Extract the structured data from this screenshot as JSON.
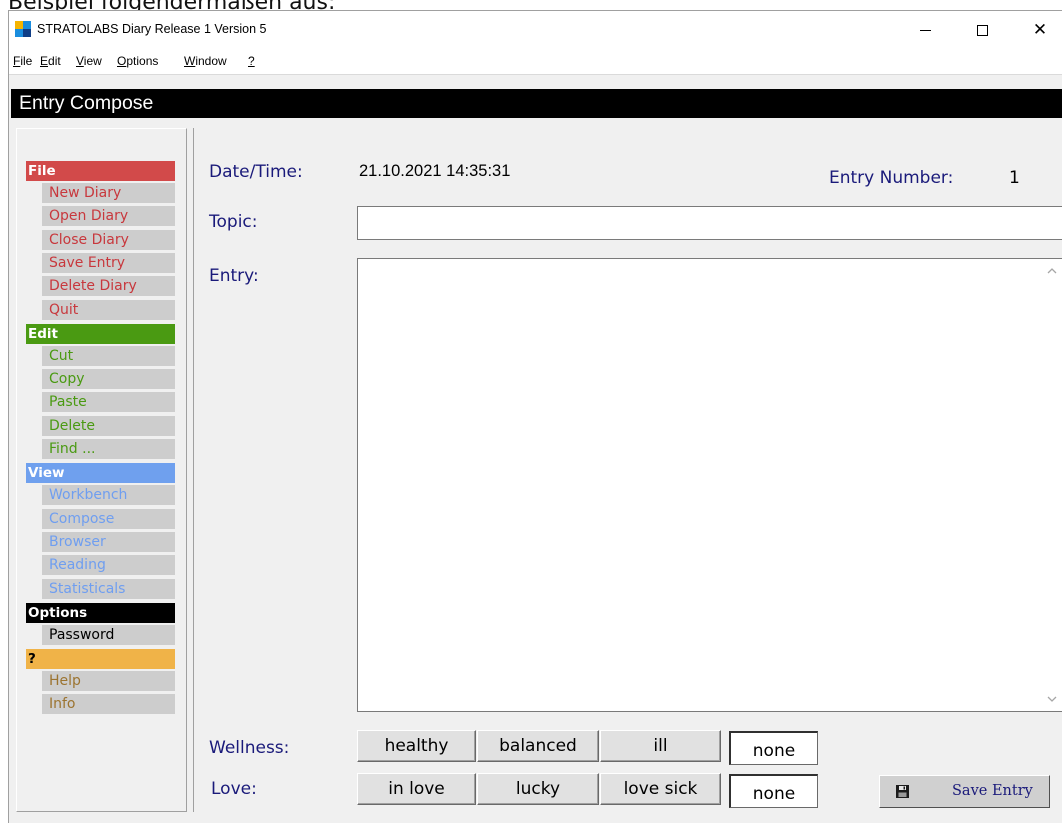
{
  "caption": "Beispiel folgendermaßen aus:",
  "window": {
    "title": "STRATOLABS Diary Release 1 Version 5",
    "controls": {
      "minimize": "—",
      "maximize": "☐",
      "close": "✕"
    }
  },
  "menubar": [
    {
      "u": "F",
      "rest": "ile"
    },
    {
      "u": "E",
      "rest": "dit"
    },
    {
      "u": "V",
      "rest": "iew"
    },
    {
      "u": "O",
      "rest": "ptions"
    },
    {
      "u": "W",
      "rest": "indow"
    },
    {
      "u": "?",
      "rest": ""
    }
  ],
  "section_title": "Entry Compose",
  "sidebar": {
    "groups": [
      {
        "title": "File",
        "head_bg": "#d24a4a",
        "head_color": "#ffffff",
        "item_color": "#c8383d",
        "items": [
          "New Diary",
          "Open Diary",
          "Close Diary",
          "Save Entry",
          "Delete Diary",
          "Quit"
        ]
      },
      {
        "title": "Edit",
        "head_bg": "#4a9a12",
        "head_color": "#ffffff",
        "item_color": "#4a9a12",
        "items": [
          "Cut",
          "Copy",
          "Paste",
          "Delete",
          "Find ..."
        ]
      },
      {
        "title": "View",
        "head_bg": "#6fa0ee",
        "head_color": "#ffffff",
        "item_color": "#6f9ef0",
        "items": [
          "Workbench",
          "Compose",
          "Browser",
          "Reading",
          "Statisticals"
        ]
      },
      {
        "title": "Options",
        "head_bg": "#000000",
        "head_color": "#ffffff",
        "item_color": "#000000",
        "items": [
          "Password"
        ]
      },
      {
        "title": "?",
        "head_bg": "#f0b348",
        "head_color": "#000000",
        "item_color": "#9c7430",
        "items": [
          "Help",
          "Info"
        ]
      }
    ]
  },
  "form": {
    "datetime_label": "Date/Time:",
    "datetime_value": "21.10.2021 14:35:31",
    "entry_number_label": "Entry Number:",
    "entry_number_value": "1",
    "topic_label": "Topic:",
    "topic_value": "",
    "entry_label": "Entry:",
    "entry_value": "",
    "wellness_label": "Wellness:",
    "wellness_options": [
      "healthy",
      "balanced",
      "ill"
    ],
    "wellness_selected": "none",
    "love_label": "Love:",
    "love_options": [
      "in love",
      "lucky",
      "love sick"
    ],
    "love_selected": "none",
    "save_button": "Save Entry"
  },
  "colors": {
    "label_blue": "#1a1a7a",
    "header_black": "#000000",
    "nav_item_bg": "#cdcdcd"
  },
  "icons": {
    "app": "stratolabs-logo-icon",
    "save": "floppy-disk-icon",
    "scroll_up": "chevron-up-icon",
    "scroll_down": "chevron-down-icon"
  }
}
